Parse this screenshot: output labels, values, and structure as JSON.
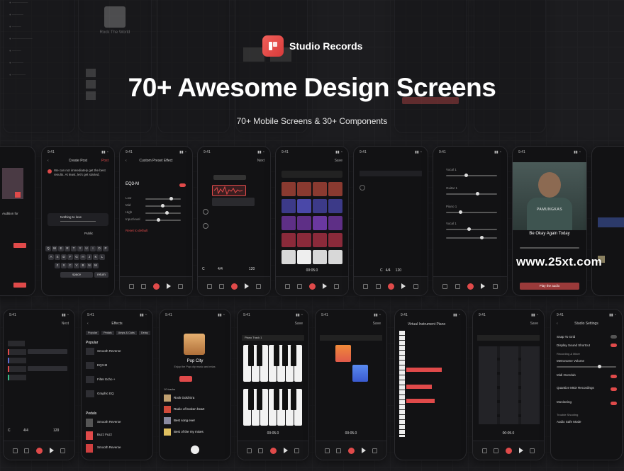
{
  "brand": {
    "name": "Studio Records"
  },
  "hero": {
    "title": "70+ Awesome Design Screens",
    "subtitle": "70+ Mobile Screens & 30+ Components"
  },
  "watermark": "www.25xt.com",
  "screens": {
    "create_post": {
      "status_time": "9:41",
      "title": "Create Post",
      "action": "Post",
      "body": "We can not immediately get the best results. At least, let's get started.",
      "track": "Nothing to lose",
      "visibility": "Public",
      "space": "space",
      "return": "return"
    },
    "eq": {
      "status_time": "9:41",
      "title": "Custom Preset Effect",
      "preset": "EQ3-M",
      "rows": [
        "Low",
        "Mid",
        "High",
        "Input level"
      ],
      "reset": "Reset to default"
    },
    "pop_city": {
      "title": "Pop City",
      "subtitle": "Enjoy the Pop city music and relax.",
      "count": "10 tracks",
      "tracks": [
        "Rock Gold Era",
        "Radio of broken heart",
        "Best song ever",
        "Best of the my mixes"
      ]
    },
    "effects": {
      "title": "Effects",
      "tabs": [
        "Popular",
        "Pedals",
        "Amps & Cabs",
        "Delay"
      ],
      "popular": "Popular",
      "pedals": "Pedals",
      "items": [
        "Smooth Reverse",
        "EQ3-M",
        "Filter Echo +",
        "Graphic EQ"
      ],
      "pedal_items": [
        "Smooth Reverse",
        "Buzz Fuzz",
        "Smooth Reverse"
      ]
    },
    "piano": {
      "title": "Virtual Instrument Piano"
    },
    "settings": {
      "title": "Studio Settings",
      "items": [
        "Snap To Grid",
        "Display Sound Shortcut",
        "Recording & Mixer",
        "Metronome Volume",
        "Midi Overdub",
        "Quantize MIDI Recordings",
        "Monitoring",
        "Trouble Shooting",
        "Audio Safe Mode"
      ]
    },
    "song": {
      "title": "Be Okay Again Today",
      "button": "Play the audio",
      "artist_word": "PAMUNGKAS"
    },
    "transport": {
      "time": "00:05.0",
      "key": "C",
      "sig": "4/4",
      "bpm": "120",
      "track": "Piano Track 1",
      "save": "Save",
      "next": "Next"
    }
  }
}
